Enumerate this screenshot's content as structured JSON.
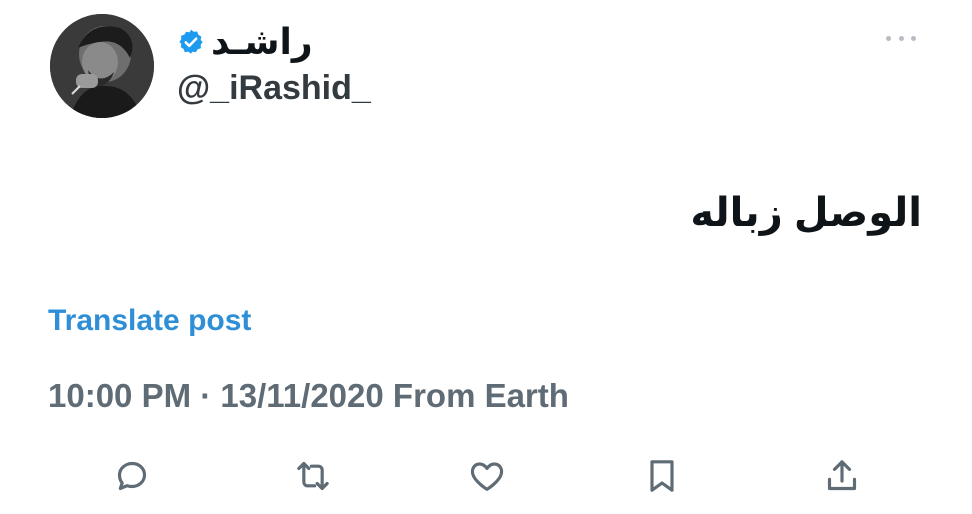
{
  "user": {
    "display_name": "راشـد",
    "handle": "@_iRashid_",
    "verified": true,
    "verified_color": "#1d9bf0"
  },
  "post": {
    "text": "الوصل زباله",
    "translate_label": "Translate post",
    "meta": "10:00 PM · 13/11/2020 From Earth"
  },
  "actions": {
    "icons": [
      "reply-icon",
      "repost-icon",
      "like-icon",
      "bookmark-icon",
      "share-icon"
    ]
  },
  "colors": {
    "link": "#2f8fd6",
    "muted": "#5f6b75",
    "text": "#0f1419"
  }
}
